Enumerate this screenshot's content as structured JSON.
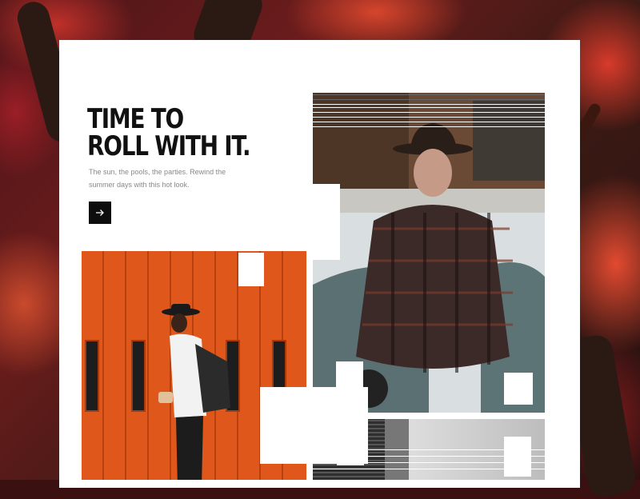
{
  "hero": {
    "headline_line1": "TIME TO",
    "headline_line2": "ROLL WITH IT.",
    "subtext": "The sun, the pools, the parties. Rewind the summer days with this hot look."
  },
  "colors": {
    "accent_orange": "#e0571c",
    "leaf_red": "#d6452c",
    "ink": "#111111"
  },
  "icons": {
    "cta": "arrow-right-icon"
  }
}
